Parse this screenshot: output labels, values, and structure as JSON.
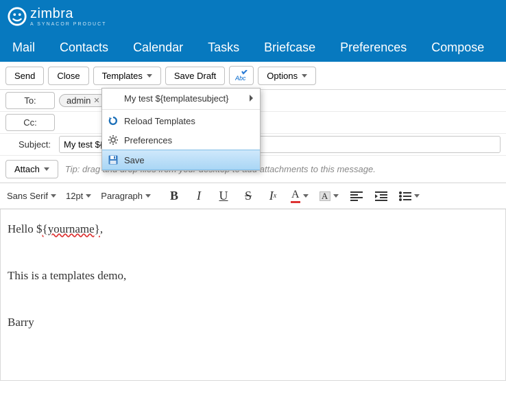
{
  "brand": {
    "name": "zimbra",
    "tagline": "A SYNACOR PRODUCT"
  },
  "tabs": [
    "Mail",
    "Contacts",
    "Calendar",
    "Tasks",
    "Briefcase",
    "Preferences",
    "Compose"
  ],
  "toolbar": {
    "send": "Send",
    "close": "Close",
    "templates": "Templates",
    "save_draft": "Save Draft",
    "options": "Options"
  },
  "templates_menu": {
    "header": "My test ${templatesubject}",
    "reload": "Reload Templates",
    "prefs": "Preferences",
    "save": "Save"
  },
  "compose": {
    "to_label": "To:",
    "cc_label": "Cc:",
    "subject_label": "Subject:",
    "to_pill": "admin",
    "subject_value": "My test ${templatesubject}",
    "attach_label": "Attach",
    "attach_tip": "Tip: drag and drop files from your desktop to add attachments to this message."
  },
  "format": {
    "font": "Sans Serif",
    "size": "12pt",
    "paragraph": "Paragraph"
  },
  "body": {
    "line1_a": "Hello $",
    "line1_b": "{yourname}",
    "line1_c": ",",
    "line2": "This is a templates demo,",
    "line3": "Barry"
  }
}
